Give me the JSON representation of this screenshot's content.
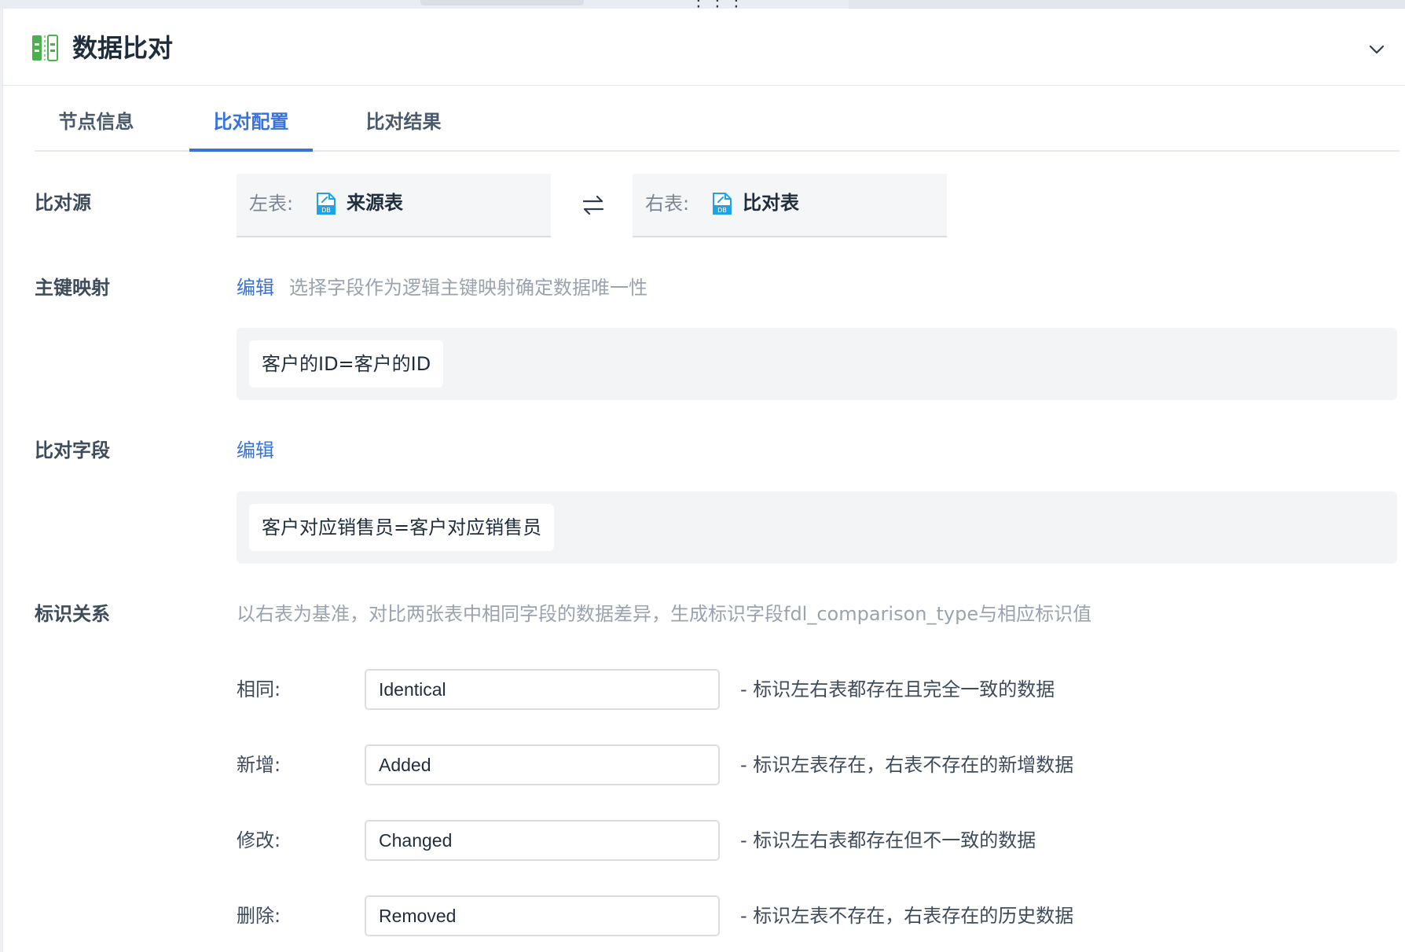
{
  "panel": {
    "title": "数据比对",
    "tabs": [
      "节点信息",
      "比对配置",
      "比对结果"
    ],
    "active_tab": 1
  },
  "source": {
    "label": "比对源",
    "left_key": "左表:",
    "left_value": "来源表",
    "right_key": "右表:",
    "right_value": "比对表"
  },
  "primary_key": {
    "label": "主键映射",
    "edit_label": "编辑",
    "hint": "选择字段作为逻辑主键映射确定数据唯一性",
    "mappings": [
      "客户的ID=客户的ID"
    ]
  },
  "compare_fields": {
    "label": "比对字段",
    "edit_label": "编辑",
    "mappings": [
      "客户对应销售员=客户对应销售员"
    ]
  },
  "identify": {
    "label": "标识关系",
    "hint": "以右表为基准，对比两张表中相同字段的数据差异，生成标识字段fdl_comparison_type与相应标识值",
    "rows": [
      {
        "label": "相同:",
        "value": "Identical",
        "desc": "- 标识左右表都存在且完全一致的数据"
      },
      {
        "label": "新增:",
        "value": "Added",
        "desc": "- 标识左表存在，右表不存在的新增数据"
      },
      {
        "label": "修改:",
        "value": "Changed",
        "desc": "- 标识左右表都存在但不一致的数据"
      },
      {
        "label": "删除:",
        "value": "Removed",
        "desc": "- 标识左表不存在，右表存在的历史数据"
      }
    ]
  },
  "colors": {
    "accent": "#3772e0",
    "icon_green": "#4caf50",
    "db_icon": "#1fa3e6"
  }
}
